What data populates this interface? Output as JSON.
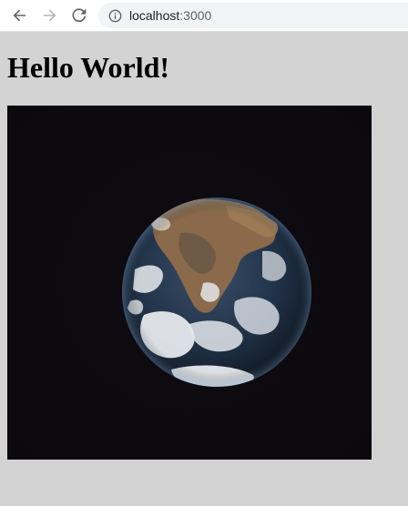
{
  "browser": {
    "url_host": "localhost",
    "url_port": ":3000"
  },
  "page": {
    "title": "Hello World!"
  }
}
